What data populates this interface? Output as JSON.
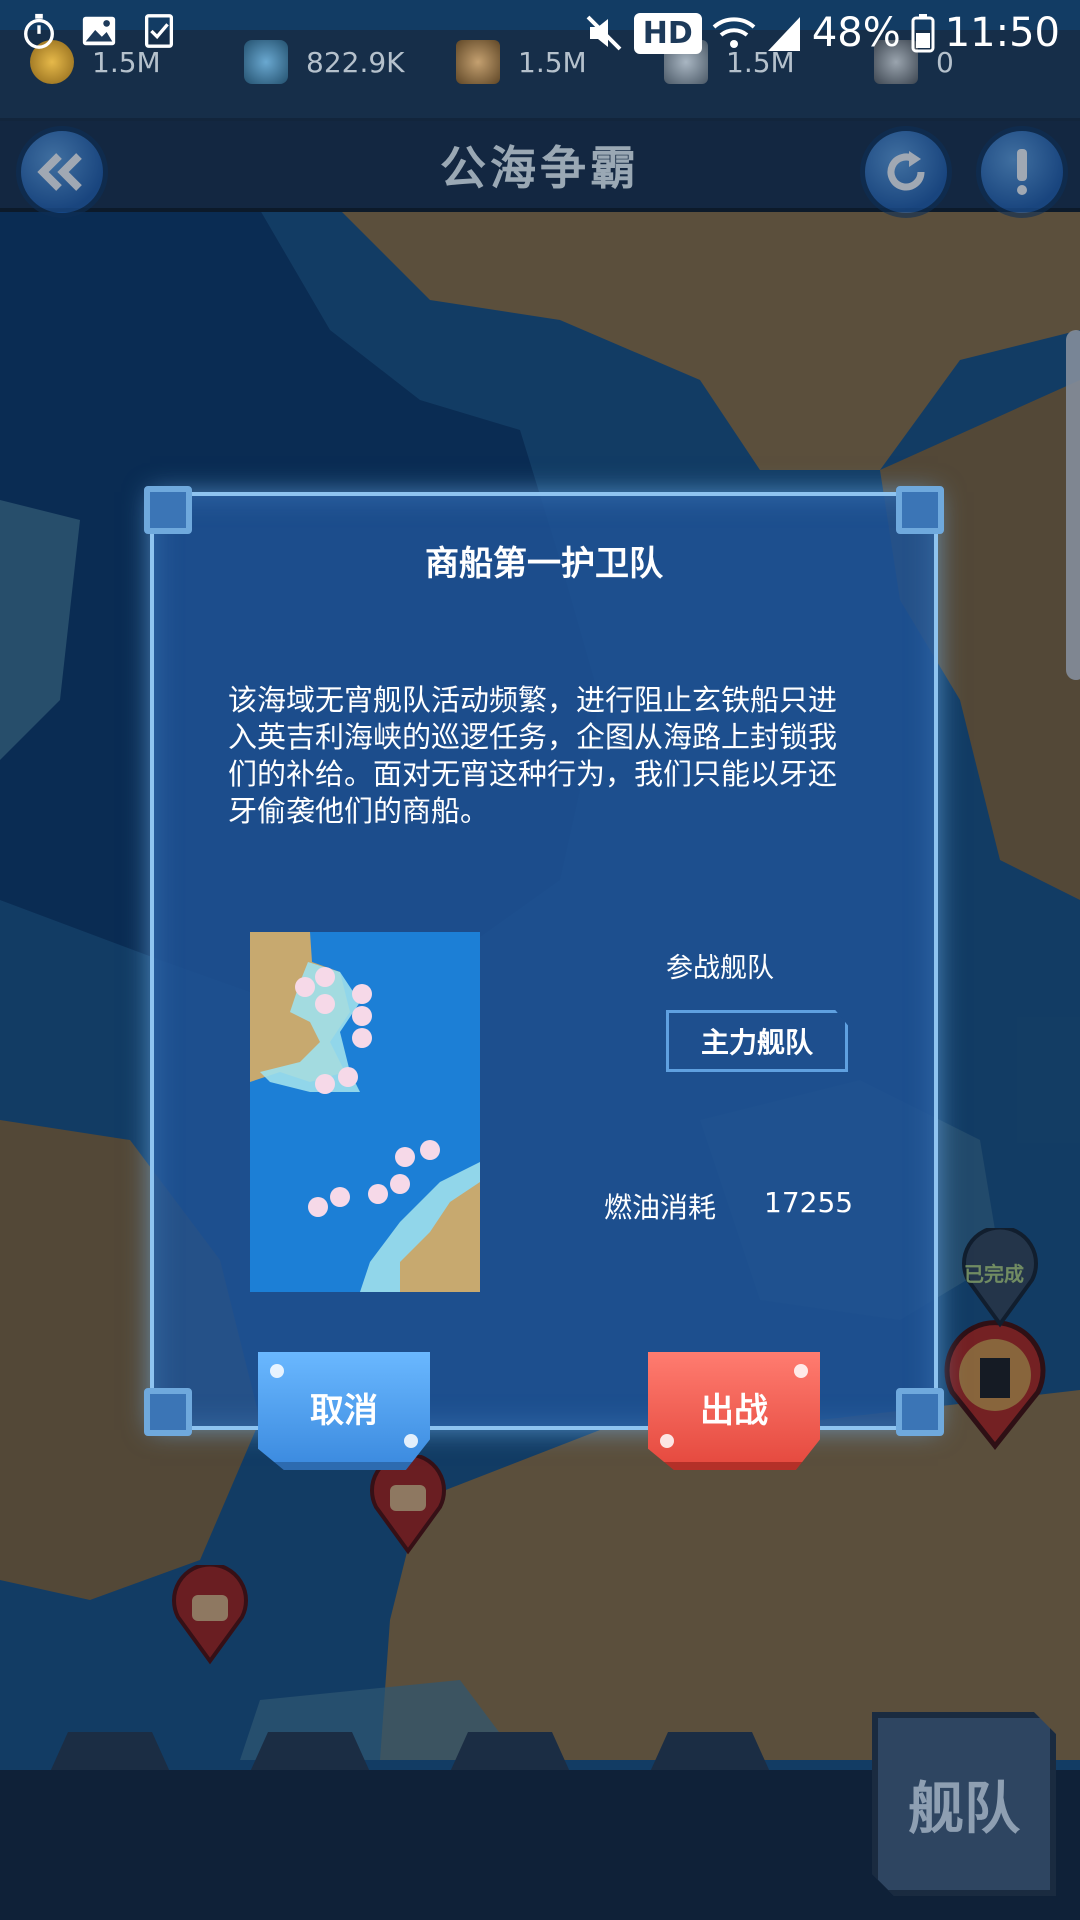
{
  "status_bar": {
    "network": "HD",
    "battery": "48%",
    "time": "11:50"
  },
  "resources": [
    {
      "icon": "coin-icon",
      "value": "1.5M"
    },
    {
      "icon": "oil-barrel-icon",
      "value": "822.9K"
    },
    {
      "icon": "ammo-shells-icon",
      "value": "1.5M"
    },
    {
      "icon": "steel-icon",
      "value": "1.5M"
    },
    {
      "icon": "wrench-icon",
      "value": "0"
    }
  ],
  "header": {
    "title": "公海争霸"
  },
  "map": {
    "completed_tag": "已完成"
  },
  "dialog": {
    "title": "商船第一护卫队",
    "description": "该海域无宵舰队活动频繁，进行阻止玄铁船只进入英吉利海峡的巡逻任务，企图从海路上封锁我们的补给。面对无宵这种行为，我们只能以牙还牙偷袭他们的商船。",
    "fleet_label": "参战舰队",
    "fleet_option": "主力舰队",
    "fuel_label": "燃油消耗",
    "fuel_value": "17255",
    "cancel_label": "取消",
    "confirm_label": "出战"
  },
  "bottom": {
    "fleet_label": "舰队"
  },
  "colors": {
    "cancel": "#4d9cf0",
    "confirm": "#f0594c",
    "dialog_bg": "#1f5294"
  }
}
